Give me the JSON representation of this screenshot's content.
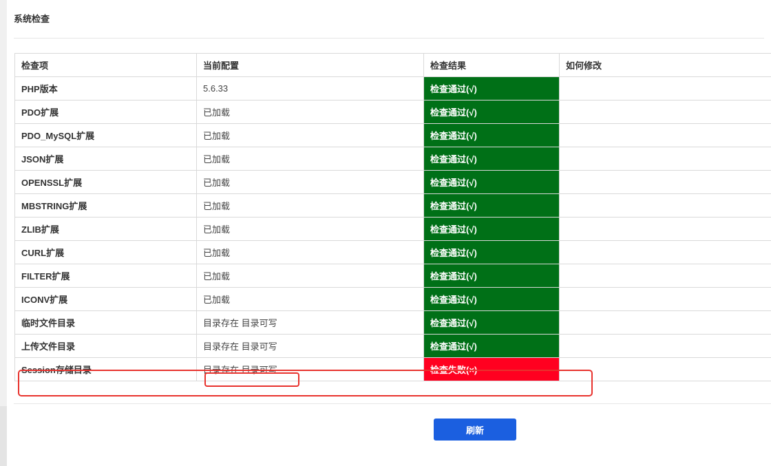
{
  "page": {
    "title": "系统检查"
  },
  "table": {
    "headers": [
      "检查项",
      "当前配置",
      "检查结果",
      "如何修改"
    ],
    "rows": [
      {
        "item": "PHP版本",
        "config": "5.6.33",
        "result": "检查通过(√)",
        "status": "pass",
        "fix": ""
      },
      {
        "item": "PDO扩展",
        "config": "已加载",
        "result": "检查通过(√)",
        "status": "pass",
        "fix": ""
      },
      {
        "item": "PDO_MySQL扩展",
        "config": "已加载",
        "result": "检查通过(√)",
        "status": "pass",
        "fix": ""
      },
      {
        "item": "JSON扩展",
        "config": "已加载",
        "result": "检查通过(√)",
        "status": "pass",
        "fix": ""
      },
      {
        "item": "OPENSSL扩展",
        "config": "已加载",
        "result": "检查通过(√)",
        "status": "pass",
        "fix": ""
      },
      {
        "item": "MBSTRING扩展",
        "config": "已加载",
        "result": "检查通过(√)",
        "status": "pass",
        "fix": ""
      },
      {
        "item": "ZLIB扩展",
        "config": "已加载",
        "result": "检查通过(√)",
        "status": "pass",
        "fix": ""
      },
      {
        "item": "CURL扩展",
        "config": "已加载",
        "result": "检查通过(√)",
        "status": "pass",
        "fix": ""
      },
      {
        "item": "FILTER扩展",
        "config": "已加载",
        "result": "检查通过(√)",
        "status": "pass",
        "fix": ""
      },
      {
        "item": "ICONV扩展",
        "config": "已加载",
        "result": "检查通过(√)",
        "status": "pass",
        "fix": ""
      },
      {
        "item": "临时文件目录",
        "config": "目录存在 目录可写",
        "result": "检查通过(√)",
        "status": "pass",
        "fix": ""
      },
      {
        "item": "上传文件目录",
        "config": "目录存在 目录可写",
        "result": "检查通过(√)",
        "status": "pass",
        "fix": ""
      },
      {
        "item": "Session存储目录",
        "config": "目录存在 目录可写",
        "result": "检查失败(×)",
        "status": "fail",
        "fix": ""
      }
    ]
  },
  "actions": {
    "refresh_label": "刷新"
  },
  "colors": {
    "pass": "#007017",
    "fail": "#ff0020",
    "button": "#1b5fe0",
    "annotation": "#e8322d"
  }
}
